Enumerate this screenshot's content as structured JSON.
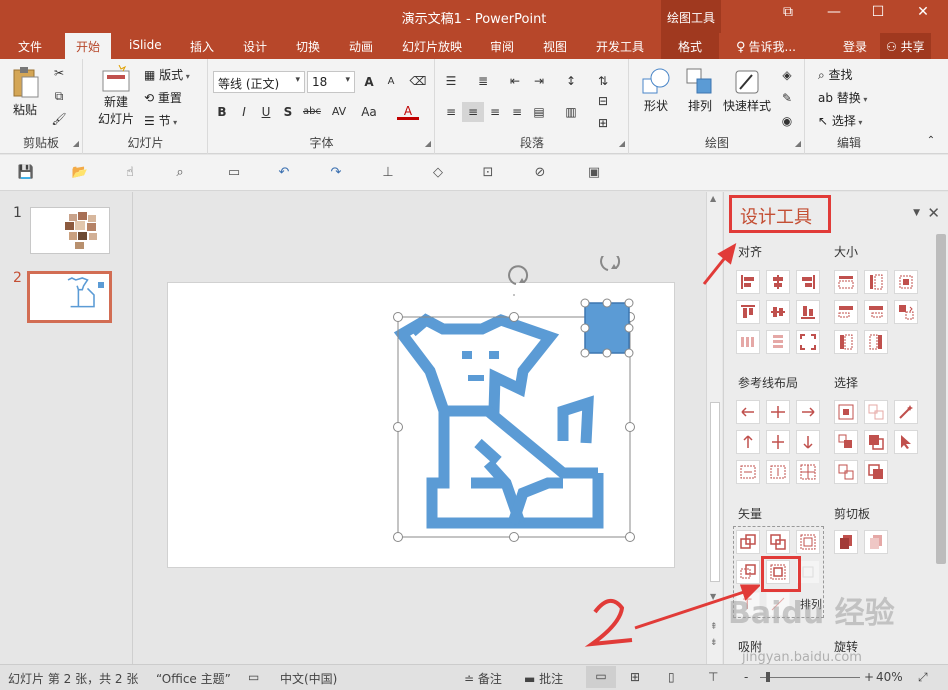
{
  "window": {
    "title": "演示文稿1 - PowerPoint",
    "context_group": "绘图工具",
    "min_label": "—",
    "max_label": "☐",
    "close_label": "✕",
    "restore_label": "⧉"
  },
  "tabs": [
    {
      "label": "文件"
    },
    {
      "label": "开始"
    },
    {
      "label": "iSlide"
    },
    {
      "label": "插入"
    },
    {
      "label": "设计"
    },
    {
      "label": "切换"
    },
    {
      "label": "动画"
    },
    {
      "label": "幻灯片放映"
    },
    {
      "label": "审阅"
    },
    {
      "label": "视图"
    },
    {
      "label": "开发工具"
    },
    {
      "label": "格式"
    }
  ],
  "tellme": "告诉我...",
  "signin": "登录",
  "share": "共享",
  "ribbon": {
    "clipboard": {
      "label": "剪贴板",
      "paste": "粘贴"
    },
    "slides": {
      "label": "幻灯片",
      "new_slide_1": "新建",
      "new_slide_2": "幻灯片",
      "layout": "版式",
      "reset": "重置",
      "section": "节"
    },
    "font": {
      "label": "字体",
      "font_name": "等线 (正文)",
      "font_size": "18",
      "bold": "B",
      "italic": "I",
      "underline": "U",
      "shadow": "S",
      "strike": "abc",
      "spacing": "AV",
      "case": "Aa",
      "color": "A",
      "grow": "A",
      "shrink": "A"
    },
    "paragraph": {
      "label": "段落"
    },
    "drawing": {
      "label": "绘图",
      "shapes": "形状",
      "arrange": "排列",
      "quick_styles": "快速样式"
    },
    "editing": {
      "label": "编辑",
      "find": "查找",
      "replace": "替换",
      "select": "选择"
    }
  },
  "thumbnails": [
    {
      "number": "1"
    },
    {
      "number": "2"
    }
  ],
  "pane": {
    "title": "设计工具",
    "sections": {
      "align": "对齐",
      "size": "大小",
      "guides": "参考线布局",
      "select": "选择",
      "vector": "矢量",
      "clipboard": "剪切板",
      "adsorb": "吸附",
      "rotate": "旋转",
      "arrange": "排列"
    }
  },
  "annotation_number": "2",
  "watermark": {
    "main": "Baidu 经验",
    "sub": "jingyan.baidu.com"
  },
  "status": {
    "slide_info": "幻灯片 第 2 张，共 2 张",
    "theme": "“Office 主题”",
    "language": "中文(中国)",
    "notes": "备注",
    "comments": "批注",
    "zoom": "40%",
    "zoom_minus": "-",
    "zoom_plus": "+"
  },
  "colors": {
    "brand": "#b7472a",
    "accent_blue": "#5b9bd5",
    "annotation_red": "#e13b38",
    "icon_red": "#c0504d"
  }
}
